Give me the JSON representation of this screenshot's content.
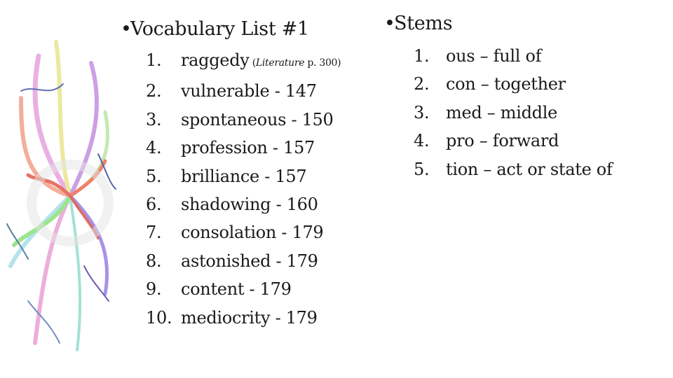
{
  "slide": {
    "left_column": {
      "heading": "Vocabulary List #1",
      "items": [
        {
          "num": "1.",
          "word": "raggedy",
          "note_prefix": " (",
          "note_source": "Literature",
          "note_suffix": " p. 300)"
        },
        {
          "num": "2.",
          "word": "vulnerable - 147"
        },
        {
          "num": "3.",
          "word": "spontaneous - 150"
        },
        {
          "num": "4.",
          "word": "profession - 157"
        },
        {
          "num": "5.",
          "word": "brilliance - 157"
        },
        {
          "num": "6.",
          "word": "shadowing - 160"
        },
        {
          "num": "7.",
          "word": "consolation - 179"
        },
        {
          "num": "8.",
          "word": "astonished - 179"
        },
        {
          "num": "9.",
          "word": "content - 179"
        },
        {
          "num": "10.",
          "word": "mediocrity - 179"
        }
      ]
    },
    "right_column": {
      "heading": "Stems",
      "items": [
        {
          "num": "1.",
          "text": "ous – full of"
        },
        {
          "num": "2.",
          "text": "con – together"
        },
        {
          "num": "3.",
          "text": "med – middle"
        },
        {
          "num": "4.",
          "text": "pro – forward"
        },
        {
          "num": "5.",
          "text": "tion – act or state of"
        }
      ]
    },
    "bullet_glyph": "•",
    "decoration": "abstract-swirl-artwork"
  }
}
